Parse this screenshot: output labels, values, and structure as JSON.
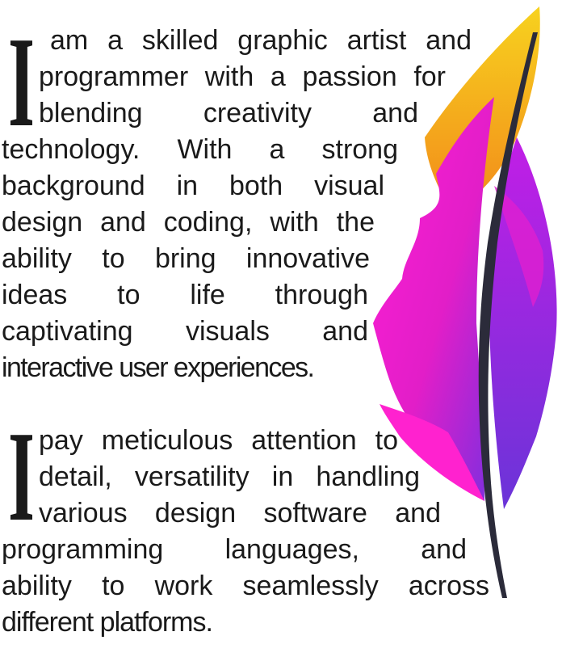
{
  "paragraphs": [
    {
      "drop_cap": "I",
      "lines": [
        "am a skilled graphic artist and",
        "programmer with a passion for",
        "blending creativity and",
        "technology. With a strong",
        "background in both visual",
        "design and coding, with the",
        "ability to bring innovative",
        "ideas to life through",
        "captivating visuals and",
        "interactive user experiences."
      ]
    },
    {
      "drop_cap": "I",
      "lines": [
        "pay meticulous attention to",
        "detail, versatility in handling",
        "various design software and",
        "programming languages, and",
        "ability to work seamlessly across",
        "different platforms."
      ]
    }
  ],
  "colors": {
    "text": "#1a1a1a",
    "feather_yellow": "#f5c518",
    "feather_orange": "#f39a1c",
    "feather_magenta": "#f020c8",
    "feather_purple": "#8a2be2",
    "quill": "#2b2b3a"
  },
  "decoration": {
    "image": "feather-illustration"
  }
}
